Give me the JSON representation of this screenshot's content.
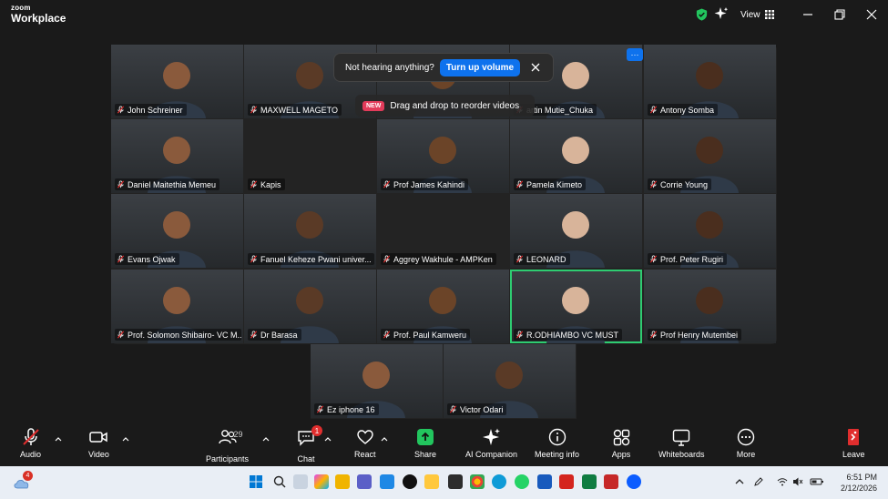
{
  "app": {
    "brand_small": "zoom",
    "brand_large": "Workplace"
  },
  "titlebar": {
    "view_label": "View"
  },
  "notice": {
    "text": "Not hearing anything?",
    "button": "Turn up volume"
  },
  "drag_tip": {
    "badge": "NEW",
    "text": "Drag and drop to reorder videos"
  },
  "participants": [
    {
      "name": "John Schreiner",
      "video": true
    },
    {
      "name": "MAXWELL MAGETO",
      "video": true
    },
    {
      "name": "",
      "video": true
    },
    {
      "name": "artin Mutie_Chuka",
      "video": true
    },
    {
      "name": "Antony Somba",
      "video": true
    },
    {
      "name": "Daniel Maitethia Memeu",
      "video": true
    },
    {
      "name": "Kapis",
      "video": false
    },
    {
      "name": "Prof James Kahindi",
      "video": true
    },
    {
      "name": "Pamela Kimeto",
      "video": true
    },
    {
      "name": "Corrie Young",
      "video": true
    },
    {
      "name": "Evans Ojwak",
      "video": true
    },
    {
      "name": "Fanuel Keheze Pwani univer...",
      "video": true
    },
    {
      "name": "Aggrey Wakhule - AMPKen",
      "video": false
    },
    {
      "name": "LEONARD",
      "video": true
    },
    {
      "name": "Prof. Peter Rugiri",
      "video": true
    },
    {
      "name": "Prof. Solomon Shibairo- VC M...",
      "video": true
    },
    {
      "name": "Dr Barasa",
      "video": true
    },
    {
      "name": "Prof. Paul Kamweru",
      "video": true
    },
    {
      "name": "R.ODHIAMBO VC MUST",
      "video": true
    },
    {
      "name": "Prof Henry Mutembei",
      "video": true
    },
    {
      "name": "Ez iphone 16",
      "video": true
    },
    {
      "name": "Victor Odari",
      "video": true
    }
  ],
  "toolbar": {
    "audio": "Audio",
    "video": "Video",
    "participants": "Participants",
    "participants_count": "29",
    "chat": "Chat",
    "chat_badge": "1",
    "react": "React",
    "share": "Share",
    "ai": "AI Companion",
    "meeting_info": "Meeting info",
    "apps": "Apps",
    "whiteboards": "Whiteboards",
    "more": "More",
    "leave": "Leave"
  },
  "taskbar": {
    "weather_badge": "4",
    "time": "6:51 PM",
    "date": "2/12/2026"
  },
  "colors": {
    "accent": "#0e72ed",
    "active_speaker": "#2ecc71",
    "muted": "#e02e2e",
    "share": "#22c55e"
  }
}
